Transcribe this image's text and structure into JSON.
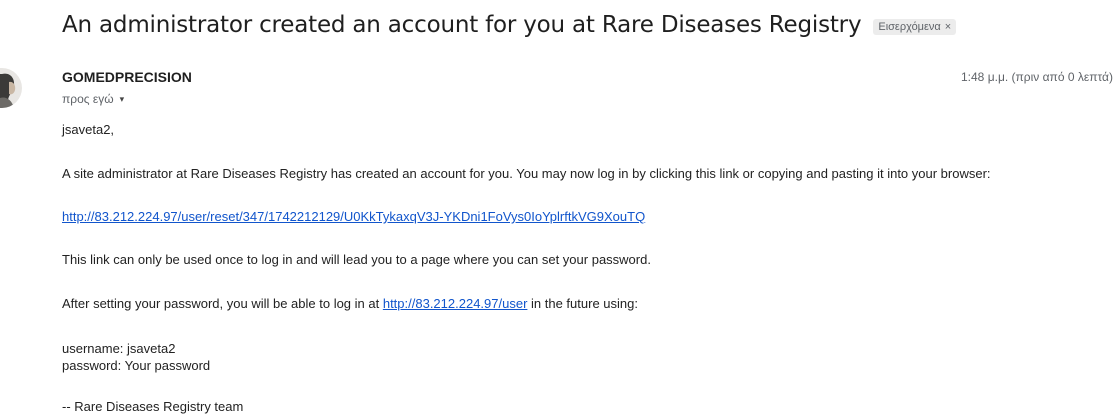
{
  "email": {
    "subject": "An administrator created an account for you at Rare Diseases Registry",
    "label": "Εισερχόμενα",
    "label_close": "×",
    "sender": "GOMEDPRECISION",
    "to_text": "προς εγώ",
    "to_caret": "▾",
    "timestamp": "1:48 μ.μ. (πριν από 0 λεπτά)"
  },
  "body": {
    "greeting": "jsaveta2,",
    "intro": "A site administrator at Rare Diseases Registry has created an account for you. You may now log in by clicking this link or copying and pasting it into your browser:",
    "reset_link": "http://83.212.224.97/user/reset/347/1742212129/U0KkTykaxqV3J-YKDni1FoVys0IoYplrftkVG9XouTQ",
    "once_notice": "This link can only be used once to log in and will lead you to a page where you can set your password.",
    "after_prefix": "After setting your password, you will be able to log in at ",
    "login_link": "http://83.212.224.97/user",
    "after_suffix": " in the future using:",
    "username_line": "username: jsaveta2",
    "password_line": "password: Your password",
    "signature": "--  Rare Diseases Registry team"
  },
  "colors": {
    "link": "#1155cc",
    "chip_bg": "#ececec",
    "muted_text": "#5f6368"
  }
}
